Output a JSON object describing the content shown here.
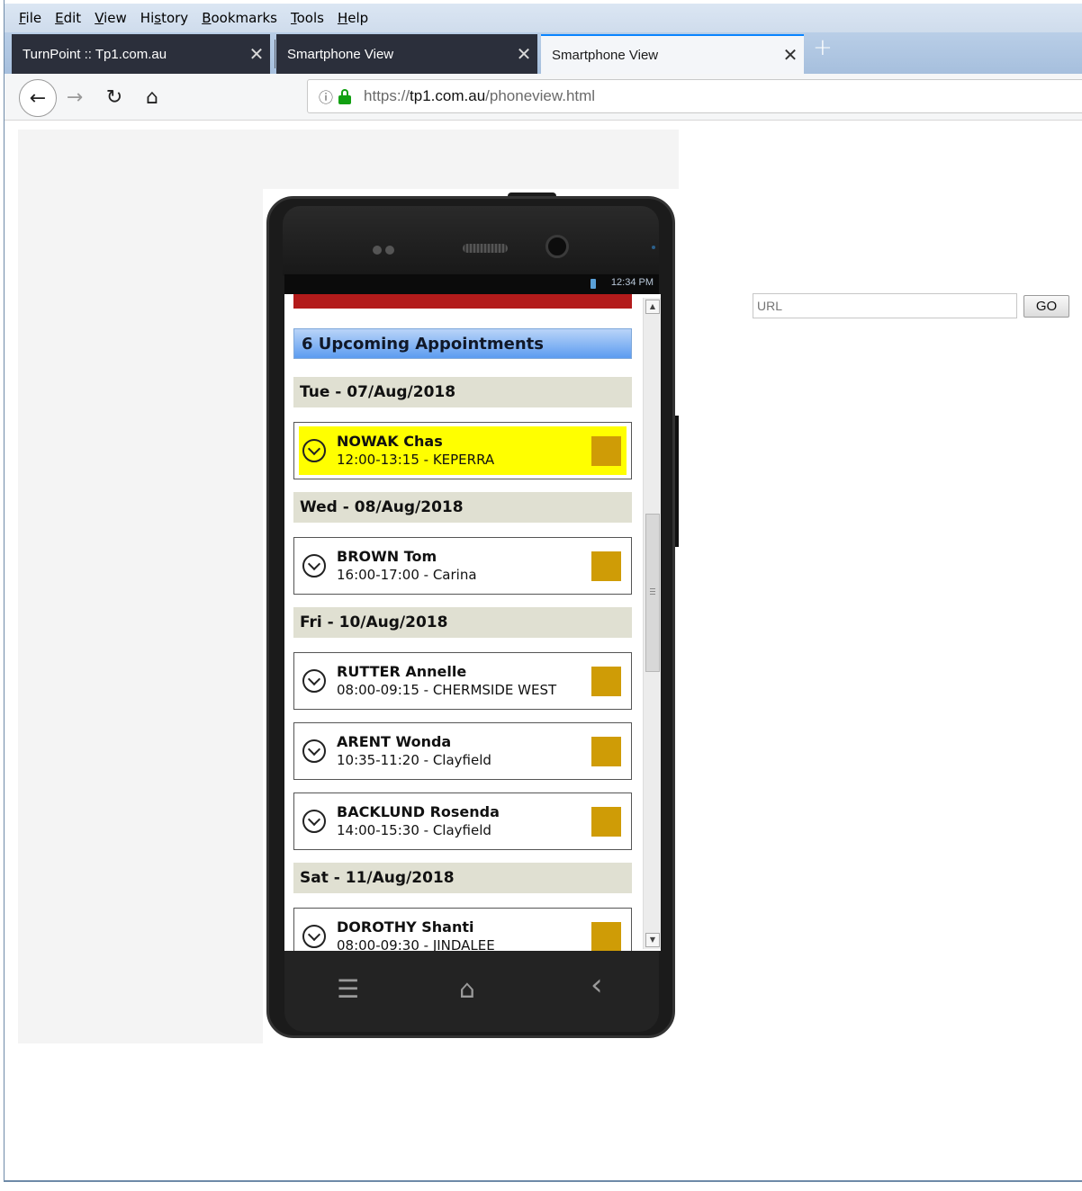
{
  "menu": [
    {
      "underline": "F",
      "rest": "ile"
    },
    {
      "underline": "E",
      "rest": "dit"
    },
    {
      "underline": "V",
      "rest": "iew"
    },
    {
      "pre": "Hi",
      "underline": "s",
      "rest": "tory"
    },
    {
      "underline": "B",
      "rest": "ookmarks"
    },
    {
      "underline": "T",
      "rest": "ools"
    },
    {
      "underline": "H",
      "rest": "elp"
    }
  ],
  "tabs": [
    {
      "title": "TurnPoint :: Tp1.com.au",
      "close": "✕"
    },
    {
      "title": "Smartphone View",
      "close": "✕"
    },
    {
      "title": "Smartphone View",
      "close": "✕"
    }
  ],
  "new_tab": "+",
  "nav": {
    "back": "←",
    "forward": "→",
    "reload": "↻",
    "home": "⌂",
    "info": "ⓘ",
    "url_scheme": "https://",
    "url_host": "tp1.com.au",
    "url_path": "/phoneview.html"
  },
  "phone": {
    "status_time": "12:34 PM",
    "header": "6 Upcoming Appointments",
    "days": [
      {
        "label": "Tue - 07/Aug/2018",
        "appointments": [
          {
            "name": "NOWAK Chas",
            "time": "12:00-13:15 - KEPERRA",
            "highlighted": true
          }
        ]
      },
      {
        "label": "Wed - 08/Aug/2018",
        "appointments": [
          {
            "name": "BROWN Tom",
            "time": "16:00-17:00 - Carina",
            "highlighted": false
          }
        ]
      },
      {
        "label": "Fri - 10/Aug/2018",
        "appointments": [
          {
            "name": "RUTTER Annelle",
            "time": "08:00-09:15 - CHERMSIDE WEST",
            "highlighted": false
          },
          {
            "name": "ARENT Wonda",
            "time": "10:35-11:20 - Clayfield",
            "highlighted": false
          },
          {
            "name": "BACKLUND Rosenda",
            "time": "14:00-15:30 - Clayfield",
            "highlighted": false
          }
        ]
      },
      {
        "label": "Sat - 11/Aug/2018",
        "appointments": [
          {
            "name": "DOROTHY Shanti",
            "time": "08:00-09:30 - JINDALEE",
            "highlighted": false
          }
        ]
      }
    ],
    "soft_keys": {
      "menu": "☰",
      "home": "⌂",
      "back": "‹"
    }
  },
  "colors": {
    "highlight": "#ffff00",
    "swatch": "#cf9c06",
    "red_bar": "#b31b1b",
    "day_header": "#e0e0d2"
  },
  "url_form": {
    "placeholder": "URL",
    "go_label": "GO"
  }
}
